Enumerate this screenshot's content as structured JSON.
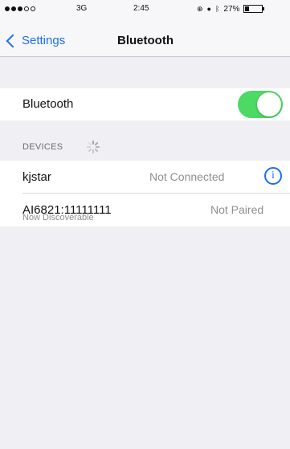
{
  "status_bar": {
    "network": "3G",
    "time": "2:45",
    "battery_percent": "27%",
    "battery_level": 0.27,
    "signal_bars_filled": 3,
    "signal_bars_total": 5,
    "icons": [
      "rotation-lock-icon",
      "alarm-icon",
      "bluetooth-icon"
    ]
  },
  "nav": {
    "back_label": "Settings",
    "title": "Bluetooth"
  },
  "bluetooth_toggle": {
    "label": "Bluetooth",
    "on": true,
    "on_color": "#4cd964"
  },
  "devices": {
    "header": "DEVICES",
    "items": [
      {
        "name": "kjstar",
        "status": "Not Connected",
        "has_info": true
      },
      {
        "name": "AI6821:11111111",
        "status": "Not Paired",
        "has_info": false
      }
    ]
  },
  "footer_note": "Now Discoverable",
  "colors": {
    "accent": "#1e6ef0",
    "toggle_on": "#4cd964",
    "background": "#efeff4"
  }
}
